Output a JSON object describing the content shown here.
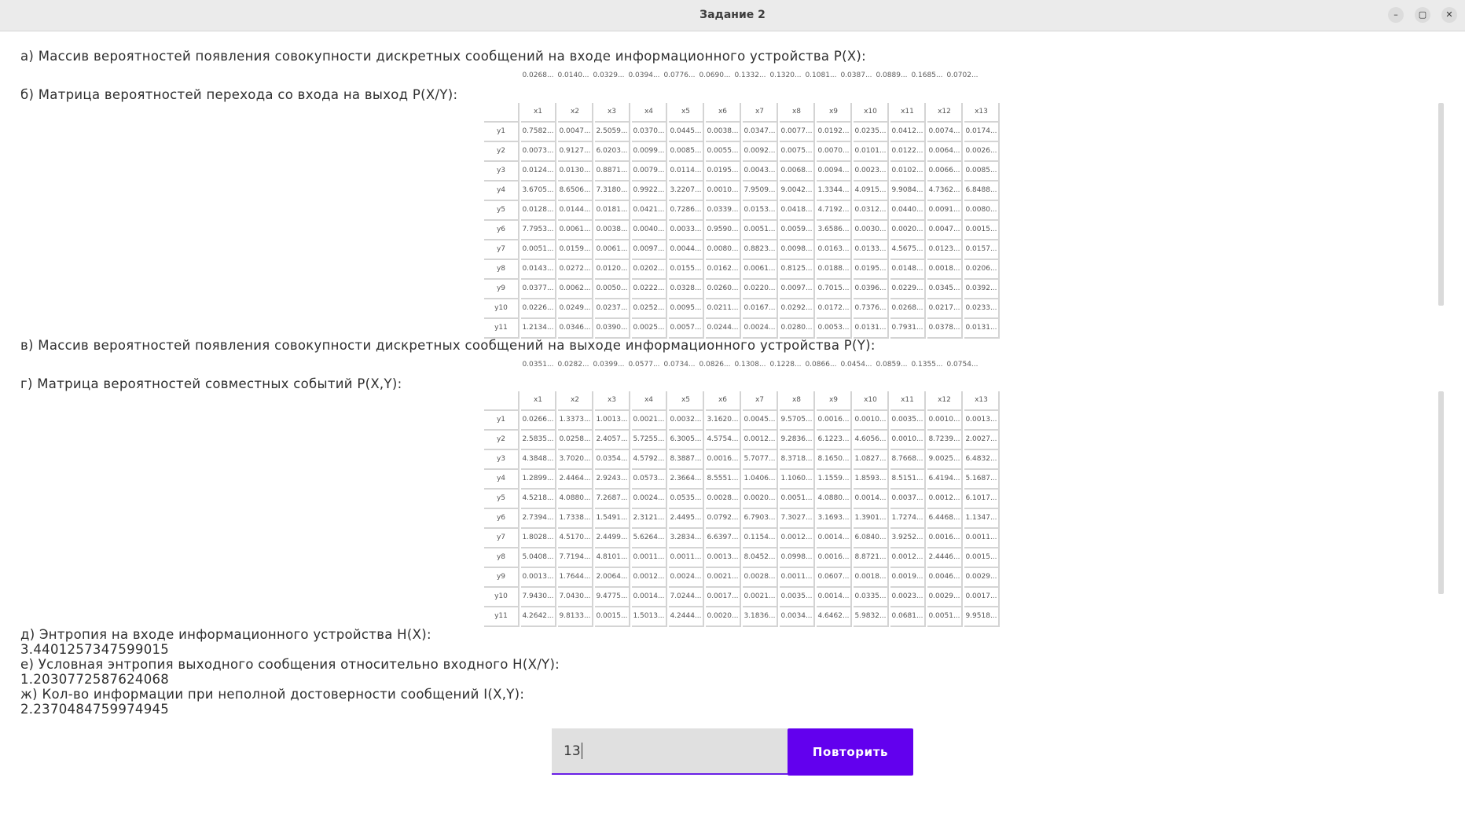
{
  "window": {
    "title": "Задание 2"
  },
  "sections": {
    "a": "а) Массив вероятностей появления совокупности дискретных сообщений на входе информационного устройства P(X):",
    "b": "б) Матрица вероятностей перехода со входа на выход P(X/Y):",
    "v": "в) Массив вероятностей появления совокупности дискретных сообщений на выходе информационного устройства P(Y):",
    "g": "г) Матрица вероятностей совместных событий P(X,Y):",
    "d": "д) Энтропия на входе информационного устройства H(X):",
    "e": "е) Условная энтропия выходного сообщения относительно входного H(X/Y):",
    "zh": "ж) Кол-во информации при неполной достоверности сообщений I(X,Y):"
  },
  "results": {
    "hx": "3.4401257347599015",
    "hxy": "1.2030772587624068",
    "ixy": "2.2370484759974945"
  },
  "px": [
    "0.0268...",
    "0.0140...",
    "0.0329...",
    "0.0394...",
    "0.0776...",
    "0.0690...",
    "0.1332...",
    "0.1320...",
    "0.1081...",
    "0.0387...",
    "0.0889...",
    "0.1685...",
    "0.0702..."
  ],
  "py": [
    "0.0351...",
    "0.0282...",
    "0.0399...",
    "0.0577...",
    "0.0734...",
    "0.0826...",
    "0.1308...",
    "0.1228...",
    "0.0866...",
    "0.0454...",
    "0.0859...",
    "0.1355...",
    "0.0754..."
  ],
  "col_headers": [
    "x1",
    "x2",
    "x3",
    "x4",
    "x5",
    "x6",
    "x7",
    "x8",
    "x9",
    "x10",
    "x11",
    "x12",
    "x13"
  ],
  "row_headers": [
    "y1",
    "y2",
    "y3",
    "y4",
    "y5",
    "y6",
    "y7",
    "y8",
    "y9",
    "y10",
    "y11"
  ],
  "pxy_cond": [
    [
      "0.7582...",
      "0.0047...",
      "2.5059...",
      "0.0370...",
      "0.0445...",
      "0.0038...",
      "0.0347...",
      "0.0077...",
      "0.0192...",
      "0.0235...",
      "0.0412...",
      "0.0074...",
      "0.0174..."
    ],
    [
      "0.0073...",
      "0.9127...",
      "6.0203...",
      "0.0099...",
      "0.0085...",
      "0.0055...",
      "0.0092...",
      "0.0075...",
      "0.0070...",
      "0.0101...",
      "0.0122...",
      "0.0064...",
      "0.0026..."
    ],
    [
      "0.0124...",
      "0.0130...",
      "0.8871...",
      "0.0079...",
      "0.0114...",
      "0.0195...",
      "0.0043...",
      "0.0068...",
      "0.0094...",
      "0.0023...",
      "0.0102...",
      "0.0066...",
      "0.0085..."
    ],
    [
      "3.6705...",
      "8.6506...",
      "7.3180...",
      "0.9922...",
      "3.2207...",
      "0.0010...",
      "7.9509...",
      "9.0042...",
      "1.3344...",
      "4.0915...",
      "9.9084...",
      "4.7362...",
      "6.8488..."
    ],
    [
      "0.0128...",
      "0.0144...",
      "0.0181...",
      "0.0421...",
      "0.7286...",
      "0.0339...",
      "0.0153...",
      "0.0418...",
      "4.7192...",
      "0.0312...",
      "0.0440...",
      "0.0091...",
      "0.0080..."
    ],
    [
      "7.7953...",
      "0.0061...",
      "0.0038...",
      "0.0040...",
      "0.0033...",
      "0.9590...",
      "0.0051...",
      "0.0059...",
      "3.6586...",
      "0.0030...",
      "0.0020...",
      "0.0047...",
      "0.0015..."
    ],
    [
      "0.0051...",
      "0.0159...",
      "0.0061...",
      "0.0097...",
      "0.0044...",
      "0.0080...",
      "0.8823...",
      "0.0098...",
      "0.0163...",
      "0.0133...",
      "4.5675...",
      "0.0123...",
      "0.0157..."
    ],
    [
      "0.0143...",
      "0.0272...",
      "0.0120...",
      "0.0202...",
      "0.0155...",
      "0.0162...",
      "0.0061...",
      "0.8125...",
      "0.0188...",
      "0.0195...",
      "0.0148...",
      "0.0018...",
      "0.0206..."
    ],
    [
      "0.0377...",
      "0.0062...",
      "0.0050...",
      "0.0222...",
      "0.0328...",
      "0.0260...",
      "0.0220...",
      "0.0097...",
      "0.7015...",
      "0.0396...",
      "0.0229...",
      "0.0345...",
      "0.0392..."
    ],
    [
      "0.0226...",
      "0.0249...",
      "0.0237...",
      "0.0252...",
      "0.0095...",
      "0.0211...",
      "0.0167...",
      "0.0292...",
      "0.0172...",
      "0.7376...",
      "0.0268...",
      "0.0217...",
      "0.0233..."
    ],
    [
      "1.2134...",
      "0.0346...",
      "0.0390...",
      "0.0025...",
      "0.0057...",
      "0.0244...",
      "0.0024...",
      "0.0280...",
      "0.0053...",
      "0.0131...",
      "0.7931...",
      "0.0378...",
      "0.0131..."
    ]
  ],
  "pxy_joint": [
    [
      "0.0266...",
      "1.3373...",
      "1.0013...",
      "0.0021...",
      "0.0032...",
      "3.1620...",
      "0.0045...",
      "9.5705...",
      "0.0016...",
      "0.0010...",
      "0.0035...",
      "0.0010...",
      "0.0013..."
    ],
    [
      "2.5835...",
      "0.0258...",
      "2.4057...",
      "5.7255...",
      "6.3005...",
      "4.5754...",
      "0.0012...",
      "9.2836...",
      "6.1223...",
      "4.6056...",
      "0.0010...",
      "8.7239...",
      "2.0027..."
    ],
    [
      "4.3848...",
      "3.7020...",
      "0.0354...",
      "4.5792...",
      "8.3887...",
      "0.0016...",
      "5.7077...",
      "8.3718...",
      "8.1650...",
      "1.0827...",
      "8.7668...",
      "9.0025...",
      "6.4832..."
    ],
    [
      "1.2899...",
      "2.4464...",
      "2.9243...",
      "0.0573...",
      "2.3664...",
      "8.5551...",
      "1.0406...",
      "1.1060...",
      "1.1559...",
      "1.8593...",
      "8.5151...",
      "6.4194...",
      "5.1687..."
    ],
    [
      "4.5218...",
      "4.0880...",
      "7.2687...",
      "0.0024...",
      "0.0535...",
      "0.0028...",
      "0.0020...",
      "0.0051...",
      "4.0880...",
      "0.0014...",
      "0.0037...",
      "0.0012...",
      "6.1017..."
    ],
    [
      "2.7394...",
      "1.7338...",
      "1.5491...",
      "2.3121...",
      "2.4495...",
      "0.0792...",
      "6.7903...",
      "7.3027...",
      "3.1693...",
      "1.3901...",
      "1.7274...",
      "6.4468...",
      "1.1347..."
    ],
    [
      "1.8028...",
      "4.5170...",
      "2.4499...",
      "5.6264...",
      "3.2834...",
      "6.6397...",
      "0.1154...",
      "0.0012...",
      "0.0014...",
      "6.0840...",
      "3.9252...",
      "0.0016...",
      "0.0011..."
    ],
    [
      "5.0408...",
      "7.7194...",
      "4.8101...",
      "0.0011...",
      "0.0011...",
      "0.0013...",
      "8.0452...",
      "0.0998...",
      "0.0016...",
      "8.8721...",
      "0.0012...",
      "2.4446...",
      "0.0015..."
    ],
    [
      "0.0013...",
      "1.7644...",
      "2.0064...",
      "0.0012...",
      "0.0024...",
      "0.0021...",
      "0.0028...",
      "0.0011...",
      "0.0607...",
      "0.0018...",
      "0.0019...",
      "0.0046...",
      "0.0029..."
    ],
    [
      "7.9430...",
      "7.0430...",
      "9.4775...",
      "0.0014...",
      "7.0244...",
      "0.0017...",
      "0.0021...",
      "0.0035...",
      "0.0014...",
      "0.0335...",
      "0.0023...",
      "0.0029...",
      "0.0017..."
    ],
    [
      "4.2642...",
      "9.8133...",
      "0.0015...",
      "1.5013...",
      "4.2444...",
      "0.0020...",
      "3.1836...",
      "0.0034...",
      "4.6462...",
      "5.9832...",
      "0.0681...",
      "0.0051...",
      "9.9518..."
    ]
  ],
  "input": {
    "value": "13"
  },
  "button": {
    "label": "Повторить"
  },
  "colors": {
    "accent": "#6200ee",
    "input_bg": "#e0e0e0"
  }
}
